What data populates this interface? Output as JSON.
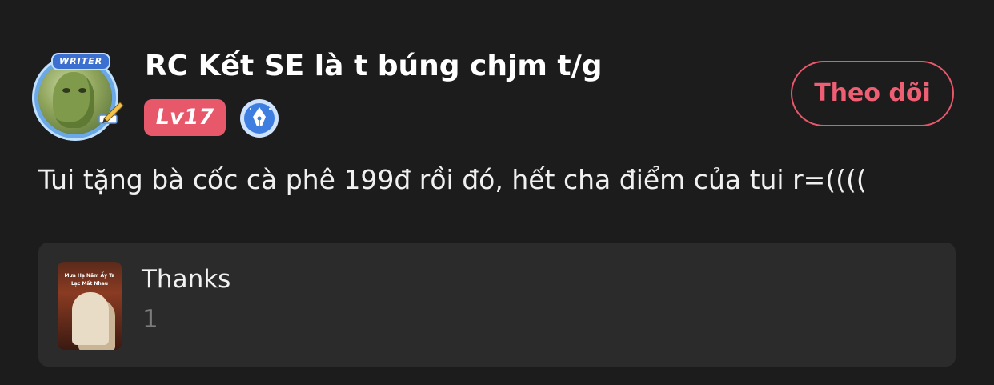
{
  "user": {
    "name": "RC Kết SE là t búng chjm t/g",
    "level": "Lv17",
    "avatar_badge": "WRITER",
    "avatar_icon": "lizard-avatar",
    "role_icon": "fountain-pen-badge-icon"
  },
  "follow": {
    "label": "Theo dõi"
  },
  "message": {
    "text": "Tui tặng bà cốc cà phê 199đ rồi đó, hết cha điểm của tui r=(((("
  },
  "gift": {
    "name": "Thanks",
    "count": "1",
    "thumb_lines": [
      "Mưa Hạ Năm Ấy Ta",
      "Lạc Mất Nhau"
    ]
  },
  "colors": {
    "background": "#1c1c1d",
    "accent": "#e8586b",
    "card": "#2b2b2c"
  }
}
